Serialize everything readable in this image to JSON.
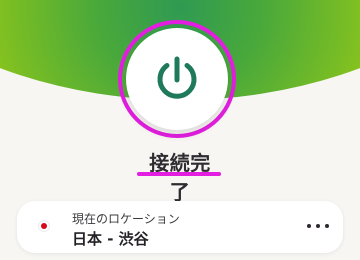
{
  "header": {
    "status_text": "接続完了"
  },
  "power_button": {
    "icon": "power-icon",
    "state": "connected"
  },
  "location": {
    "label": "現在のロケーション",
    "value": "日本 - 渋谷",
    "flag_icon": "japan-flag-icon"
  },
  "actions": {
    "more_icon": "more-options-icon"
  },
  "colors": {
    "highlight": "#e31ee0",
    "power_icon": "#1f7a5b",
    "background": "#f7f6f3",
    "gradient_start": "#2f9a52",
    "gradient_mid": "#a6cf12",
    "gradient_end": "#dfe84f"
  }
}
